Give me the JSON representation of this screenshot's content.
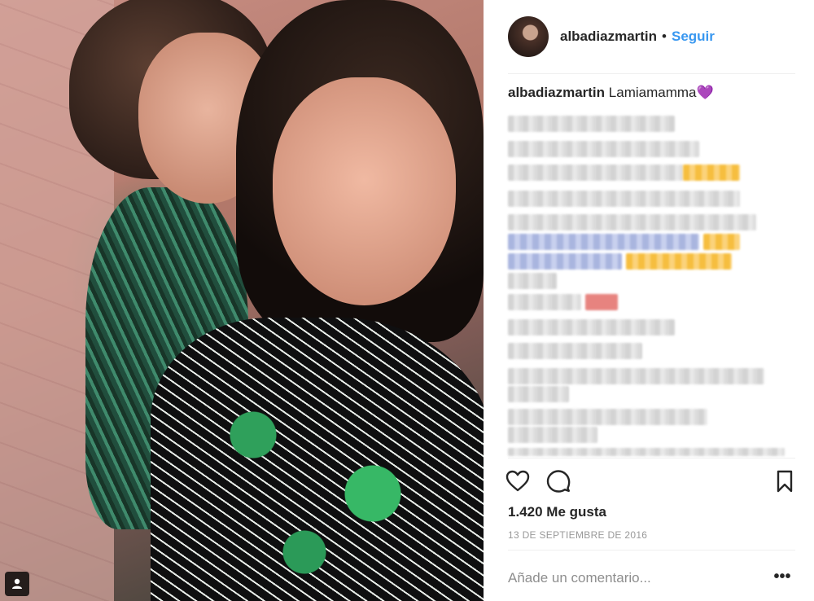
{
  "post": {
    "username": "albadiazmartin",
    "separator": "•",
    "follow_label": "Seguir",
    "caption_text": "Lamiamamma",
    "caption_emoji": "💜",
    "likes_count": "1.420",
    "likes_label": "Me gusta",
    "date": "13 DE SEPTIEMBRE DE 2016",
    "comment_placeholder": "Añade un comentario...",
    "more_label": "•••"
  },
  "icons": {
    "like": "heart-icon",
    "comment": "comment-bubble-icon",
    "save": "bookmark-icon",
    "tagged_user": "user-tag-icon"
  },
  "colors": {
    "link_blue": "#3897f0",
    "text": "#262626",
    "muted": "#999999",
    "divider": "#efefef"
  }
}
